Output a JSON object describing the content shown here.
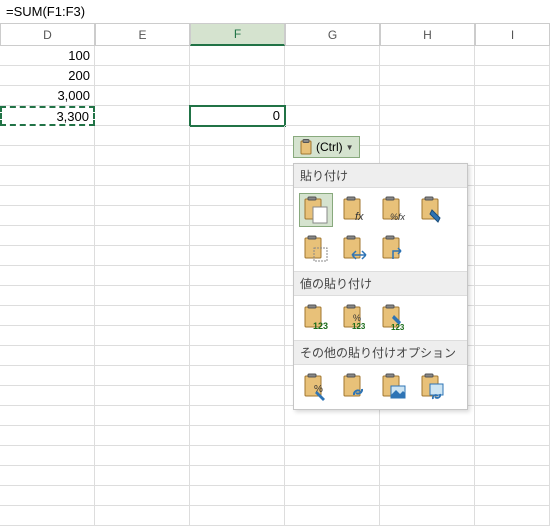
{
  "formula_bar": "=SUM(F1:F3)",
  "columns": [
    "D",
    "E",
    "F",
    "G",
    "H",
    "I"
  ],
  "active_column": "F",
  "cells": {
    "d1": "100",
    "d2": "200",
    "d3": "3,000",
    "d4": "3,300",
    "f4": "0"
  },
  "ctrl_button": {
    "label": "(Ctrl)"
  },
  "menu": {
    "section1": "貼り付け",
    "section2": "値の貼り付け",
    "section3": "その他の貼り付けオプション"
  },
  "chart_data": {
    "type": "table",
    "note": "Excel worksheet paste-options popup",
    "formula": "=SUM(F1:F3)",
    "columns": [
      "D",
      "E",
      "F",
      "G",
      "H",
      "I"
    ],
    "rows": [
      {
        "D": 100
      },
      {
        "D": 200
      },
      {
        "D": 3000
      },
      {
        "D": 3300,
        "F": 0
      }
    ],
    "copy_source": "D4",
    "selected_cell": "F4"
  }
}
